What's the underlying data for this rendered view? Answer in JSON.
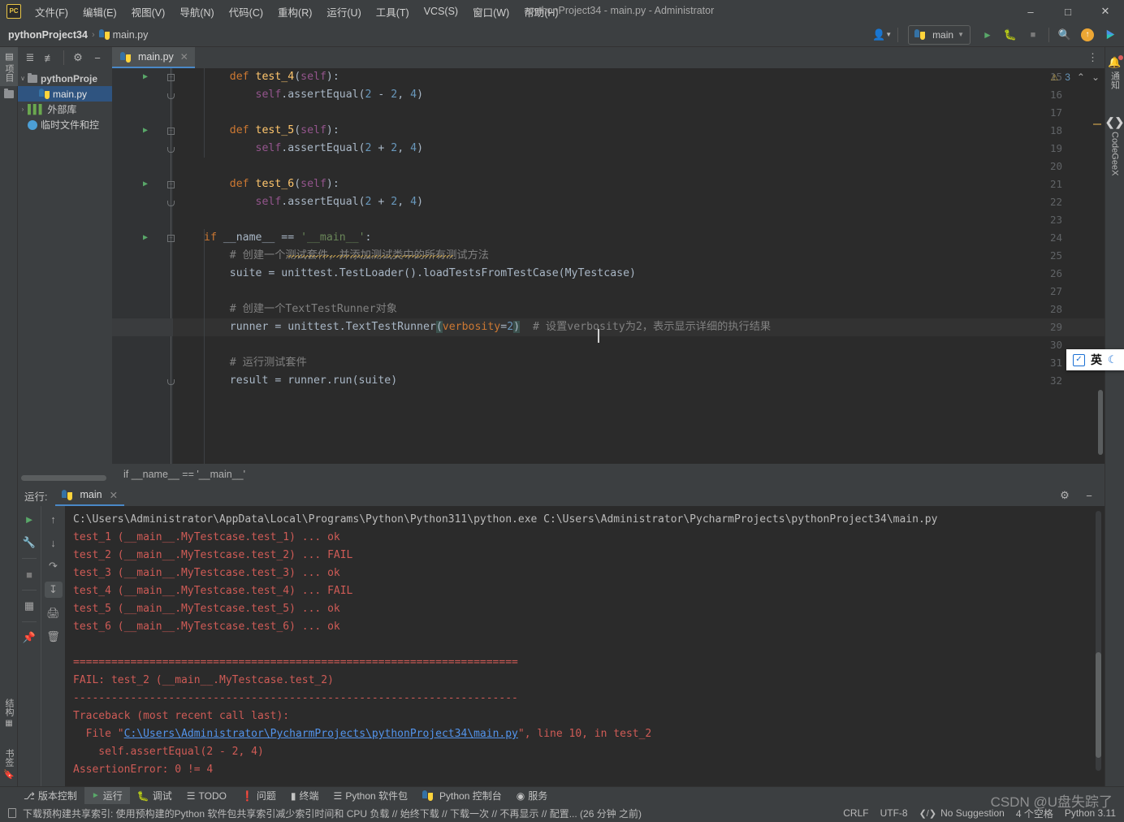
{
  "window": {
    "title": "pythonProject34 - main.py - Administrator",
    "logo": "PC",
    "minimize": "–",
    "maximize": "□",
    "close": "✕"
  },
  "menu": {
    "items": [
      {
        "label": "文件(F)"
      },
      {
        "label": "编辑(E)"
      },
      {
        "label": "视图(V)"
      },
      {
        "label": "导航(N)"
      },
      {
        "label": "代码(C)"
      },
      {
        "label": "重构(R)"
      },
      {
        "label": "运行(U)"
      },
      {
        "label": "工具(T)"
      },
      {
        "label": "VCS(S)"
      },
      {
        "label": "窗口(W)"
      },
      {
        "label": "帮助(H)"
      }
    ]
  },
  "navbar": {
    "project": "pythonProject34",
    "separator": "›",
    "file": "main.py",
    "run_config": "main",
    "dropdown_caret": "▼"
  },
  "left_rail": {
    "top_items": [
      {
        "label": "项目",
        "icon": "project-icon"
      }
    ],
    "bottom_items": [
      {
        "label": "结构",
        "icon": "structure-icon"
      },
      {
        "label": "书签",
        "icon": "bookmarks-icon"
      }
    ]
  },
  "project_panel": {
    "tree": [
      {
        "label": "pythonProje",
        "indent": 0,
        "arrow": "∨",
        "icon": "folder-icon",
        "selected": false,
        "bold": true
      },
      {
        "label": "main.py",
        "indent": 1,
        "arrow": "",
        "icon": "python-file-icon",
        "selected": true,
        "bold": false
      },
      {
        "label": "外部库",
        "indent": 0,
        "arrow": "›",
        "icon": "library-icon",
        "selected": false,
        "bold": false
      },
      {
        "label": "临时文件和控",
        "indent": 0,
        "arrow": "",
        "icon": "scratches-icon",
        "selected": false,
        "bold": false
      }
    ]
  },
  "editor": {
    "tab": {
      "label": "main.py",
      "close": "✕"
    },
    "breadcrumb_bottom": "if __name__ == '__main__'",
    "inspections": {
      "warning_count": "3",
      "up": "⌃",
      "down": "⌄"
    },
    "lines": [
      {
        "num": "15",
        "runnable": true,
        "fold": "minus",
        "code_html": "    <span class='kw'>def</span> <span class='fn'>test_4</span>(<span class='self'>self</span>):"
      },
      {
        "num": "16",
        "runnable": false,
        "fold": "round",
        "code_html": "        <span class='self'>self</span>.assertEqual(<span class='num'>2</span> - <span class='num'>2</span>, <span class='num'>4</span>)"
      },
      {
        "num": "17",
        "runnable": false,
        "fold": "",
        "code_html": ""
      },
      {
        "num": "18",
        "runnable": true,
        "fold": "minus",
        "code_html": "    <span class='kw'>def</span> <span class='fn'>test_5</span>(<span class='self'>self</span>):"
      },
      {
        "num": "19",
        "runnable": false,
        "fold": "round",
        "code_html": "        <span class='self'>self</span>.assertEqual(<span class='num'>2</span> + <span class='num'>2</span>, <span class='num'>4</span>)"
      },
      {
        "num": "20",
        "runnable": false,
        "fold": "",
        "code_html": ""
      },
      {
        "num": "21",
        "runnable": true,
        "fold": "minus",
        "code_html": "    <span class='kw'>def</span> <span class='fn'>test_6</span>(<span class='self'>self</span>):"
      },
      {
        "num": "22",
        "runnable": false,
        "fold": "round",
        "code_html": "        <span class='self'>self</span>.assertEqual(<span class='num'>2</span> + <span class='num'>2</span>, <span class='num'>4</span>)"
      },
      {
        "num": "23",
        "runnable": false,
        "fold": "",
        "code_html": ""
      },
      {
        "num": "24",
        "runnable": true,
        "fold": "minus",
        "code_html": "<span class='kw'>if</span> __name__ == <span class='str'>'__main__'</span>:"
      },
      {
        "num": "25",
        "runnable": false,
        "fold": "",
        "code_html": "    <span class='cmt'># 创建一个测试套件，并添加测试类中的所有测试方法</span>"
      },
      {
        "num": "26",
        "runnable": false,
        "fold": "",
        "code_html": "    suite = unittest.TestLoader().loadTestsFromTestCase(MyTestcase)"
      },
      {
        "num": "27",
        "runnable": false,
        "fold": "",
        "code_html": ""
      },
      {
        "num": "28",
        "runnable": false,
        "fold": "",
        "code_html": "    <span class='cmt'># 创建一个TextTestRunner对象</span>"
      },
      {
        "num": "29",
        "runnable": false,
        "fold": "",
        "code_html": "    runner = unittest.TextTestRunner<span class='brace-hl'>(</span><span class='param'>verbosity</span>=<span class='num'>2</span><span class='brace-hl'>)</span>  <span class='cmt'># 设置verbosity为2，表示显示详细的执行结果</span>"
      },
      {
        "num": "30",
        "runnable": false,
        "fold": "",
        "code_html": ""
      },
      {
        "num": "31",
        "runnable": false,
        "fold": "",
        "code_html": "    <span class='cmt'># 运行测试套件</span>"
      },
      {
        "num": "32",
        "runnable": false,
        "fold": "round",
        "code_html": "    result = runner.run(suite)"
      }
    ],
    "current_line_index": 14
  },
  "right_rail": {
    "items": [
      {
        "label": "通知",
        "icon": "bell-icon"
      },
      {
        "label": "CodeGeeX",
        "icon": "codegeex-icon"
      }
    ]
  },
  "run_panel": {
    "label": "运行:",
    "tab": {
      "label": "main",
      "close": "✕"
    },
    "console_lines": [
      {
        "text": "C:\\Users\\Administrator\\AppData\\Local\\Programs\\Python\\Python311\\python.exe C:\\Users\\Administrator\\PycharmProjects\\pythonProject34\\main.py",
        "style": "path"
      },
      {
        "text": "test_1 (__main__.MyTestcase.test_1) ... ok",
        "style": "err"
      },
      {
        "text": "test_2 (__main__.MyTestcase.test_2) ... FAIL",
        "style": "err"
      },
      {
        "text": "test_3 (__main__.MyTestcase.test_3) ... ok",
        "style": "err"
      },
      {
        "text": "test_4 (__main__.MyTestcase.test_4) ... FAIL",
        "style": "err"
      },
      {
        "text": "test_5 (__main__.MyTestcase.test_5) ... ok",
        "style": "err"
      },
      {
        "text": "test_6 (__main__.MyTestcase.test_6) ... ok",
        "style": "err"
      },
      {
        "text": "",
        "style": "err"
      },
      {
        "text": "======================================================================",
        "style": "err"
      },
      {
        "text": "FAIL: test_2 (__main__.MyTestcase.test_2)",
        "style": "err"
      },
      {
        "text": "----------------------------------------------------------------------",
        "style": "err"
      },
      {
        "text": "Traceback (most recent call last):",
        "style": "err"
      },
      {
        "text": "  File \"|C:\\Users\\Administrator\\PycharmProjects\\pythonProject34\\main.py|\", line 10, in test_2",
        "style": "err-link"
      },
      {
        "text": "    self.assertEqual(2 - 2, 4)",
        "style": "err"
      },
      {
        "text": "AssertionError: 0 != 4",
        "style": "err"
      }
    ]
  },
  "toolwindow_bar": {
    "items": [
      {
        "label": "版本控制",
        "icon": "branch-icon",
        "active": false
      },
      {
        "label": "运行",
        "icon": "run-icon",
        "active": true
      },
      {
        "label": "调试",
        "icon": "debug-icon",
        "active": false
      },
      {
        "label": "TODO",
        "icon": "todo-icon",
        "active": false
      },
      {
        "label": "问题",
        "icon": "problems-icon",
        "active": false
      },
      {
        "label": "终端",
        "icon": "terminal-icon",
        "active": false
      },
      {
        "label": "Python 软件包",
        "icon": "packages-icon",
        "active": false
      },
      {
        "label": "Python 控制台",
        "icon": "python-console-icon",
        "active": false
      },
      {
        "label": "服务",
        "icon": "services-icon",
        "active": false
      }
    ]
  },
  "statusbar": {
    "message": "下载预构建共享索引: 使用预构建的Python 软件包共享索引减少索引时间和 CPU 负载 // 始终下载 // 下载一次 // 不再显示 // 配置... (26 分钟 之前)",
    "line_sep": "CRLF",
    "encoding": "UTF-8",
    "suggestion": "No Suggestion",
    "indent": "4 个空格",
    "interpreter": "Python 3.11"
  },
  "ime": {
    "mode": "英",
    "moon": "☾"
  },
  "watermark": "CSDN @U盘失踪了",
  "colors": {
    "chrome": "#3c3f41",
    "editor_bg": "#2b2b2b",
    "accent_blue": "#4a88c7",
    "error_red": "#cf5b56",
    "link_blue": "#5394ec",
    "green_run": "#59a869"
  }
}
